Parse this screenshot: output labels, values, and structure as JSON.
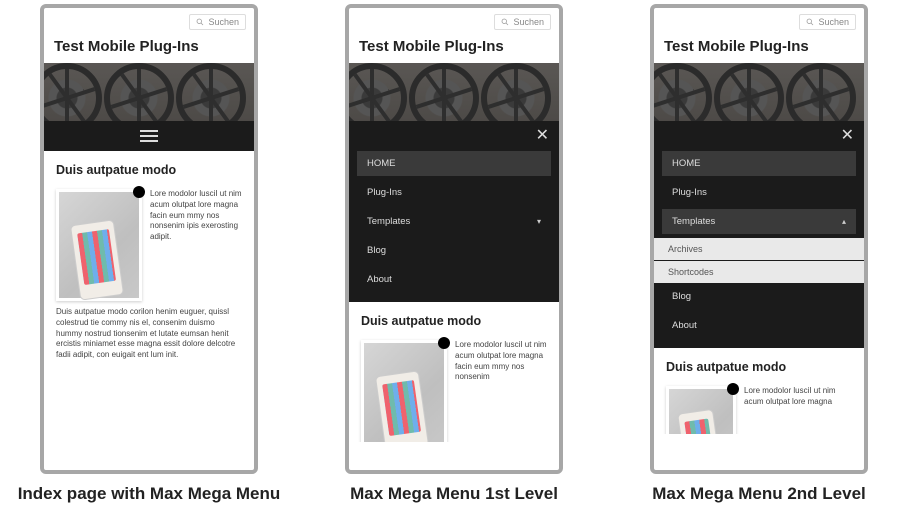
{
  "search": {
    "placeholder": "Suchen"
  },
  "site_title": "Test Mobile Plug-Ins",
  "article": {
    "heading": "Duis autpatue modo"
  },
  "lorem_short": "Lore modolor lusciI ut nim acum olutpat lore magna facin eum mmy nos nonsenim ipis exerosting adipit.",
  "lorem_extra": "Duis autpatue modo corilon henim euguer, quissl colestrud tie commy nis el, consenim duismo hummy nostrud tionsenim et lutate eumsan henit ercistis miniamet esse magna essit dolore delcotre fadii adipit, con euigait ent lum init.",
  "lorem_mid": "Lore modolor lusciI ut nim acum olutpat lore magna facin eum mmy nos nonsenim",
  "lorem_tiny": "Lore modolor lusciI ut nim acum olutpat lore magna",
  "menu": {
    "home": "HOME",
    "plugins": "Plug-Ins",
    "templates": "Templates",
    "blog": "Blog",
    "about": "About",
    "archives": "Archives",
    "shortcodes": "Shortcodes"
  },
  "captions": {
    "c1": "Index page with Max Mega Menu",
    "c2": "Max Mega Menu 1st Level",
    "c3": "Max Mega Menu 2nd Level"
  }
}
